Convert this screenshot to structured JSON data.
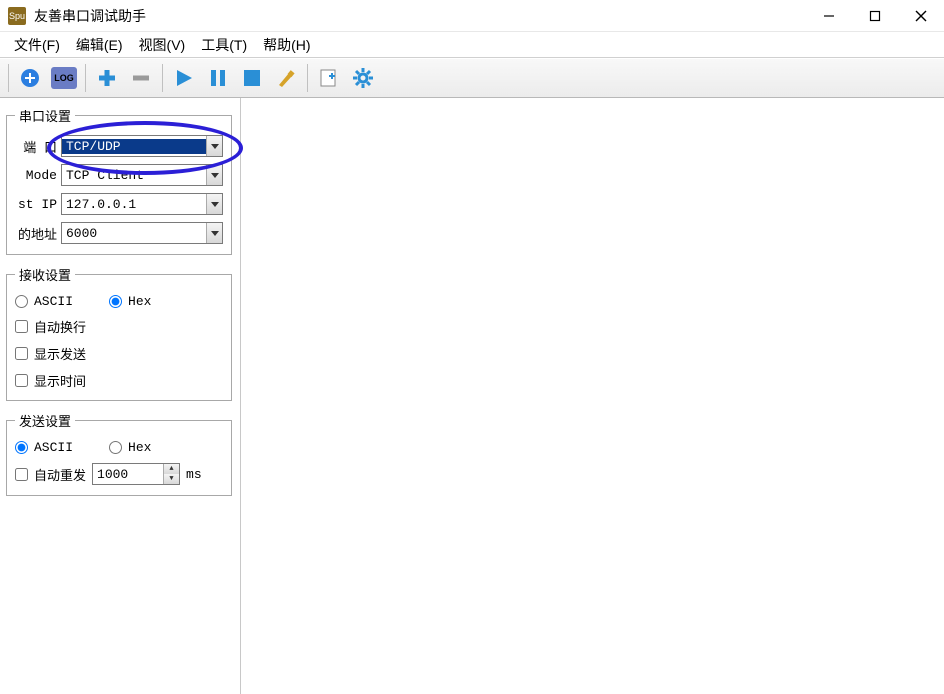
{
  "title": "友善串口调试助手",
  "menus": {
    "file": "文件(F)",
    "edit": "编辑(E)",
    "view": "视图(V)",
    "tools": "工具(T)",
    "help": "帮助(H)"
  },
  "toolbarIcons": {
    "addCircle": "blue-circle-plus",
    "log": "LOG",
    "plus": "plus",
    "minus": "minus",
    "play": "play",
    "pause": "pause",
    "stop": "stop",
    "brush": "brush",
    "newDoc": "new-doc",
    "gear": "gear"
  },
  "serial": {
    "legend": "串口设置",
    "fields": {
      "port": {
        "label": "端   口",
        "value": "TCP/UDP"
      },
      "mode": {
        "label": "Mode",
        "value": "TCP Client"
      },
      "ip": {
        "label": "st IP",
        "value": "127.0.0.1"
      },
      "addr": {
        "label": "的地址",
        "value": "6000"
      }
    }
  },
  "recv": {
    "legend": "接收设置",
    "ascii": "ASCII",
    "hex": "Hex",
    "autowrap": "自动换行",
    "showsend": "显示发送",
    "showtime": "显示时间"
  },
  "send": {
    "legend": "发送设置",
    "ascii": "ASCII",
    "hex": "Hex",
    "autorepeat": "自动重发",
    "interval": "1000",
    "unit": "ms"
  }
}
